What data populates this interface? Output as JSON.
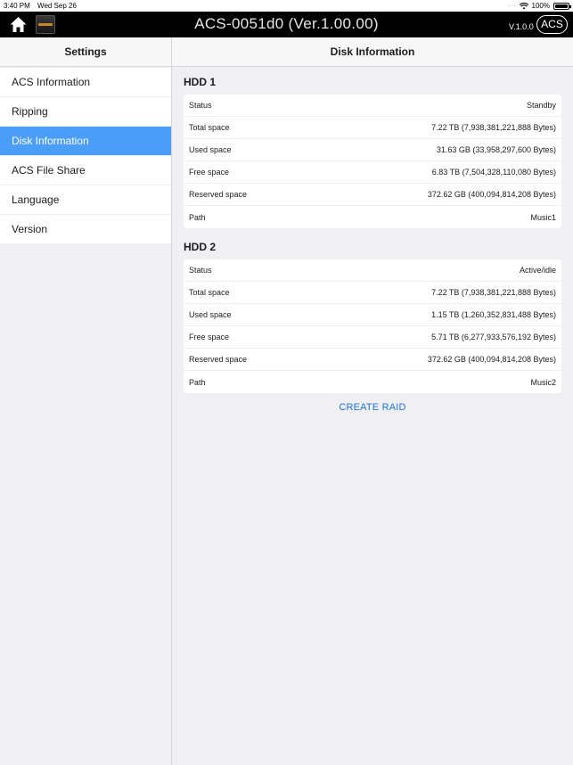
{
  "status_bar": {
    "time": "3:40 PM",
    "date": "Wed Sep 26",
    "battery": "100%",
    "battery_level": 1.0
  },
  "app_header": {
    "title": "ACS-0051d0 (Ver.1.00.00)",
    "version": "V.1.0.0",
    "badge": "ACS"
  },
  "sidebar": {
    "title": "Settings",
    "items": [
      {
        "label": "ACS Information"
      },
      {
        "label": "Ripping"
      },
      {
        "label": "Disk Information"
      },
      {
        "label": "ACS File Share"
      },
      {
        "label": "Language"
      },
      {
        "label": "Version"
      }
    ],
    "active_index": 2
  },
  "main": {
    "title": "Disk Information",
    "disks": [
      {
        "name": "HDD 1",
        "rows": [
          {
            "label": "Status",
            "value": "Standby"
          },
          {
            "label": "Total space",
            "value": "7.22 TB (7,938,381,221,888 Bytes)"
          },
          {
            "label": "Used space",
            "value": "31.63 GB (33,958,297,600 Bytes)"
          },
          {
            "label": "Free space",
            "value": "6.83 TB (7,504,328,110,080 Bytes)"
          },
          {
            "label": "Reserved space",
            "value": "372.62 GB (400,094,814,208 Bytes)"
          },
          {
            "label": "Path",
            "value": "Music1"
          }
        ]
      },
      {
        "name": "HDD 2",
        "rows": [
          {
            "label": "Status",
            "value": "Active/idle"
          },
          {
            "label": "Total space",
            "value": "7.22 TB (7,938,381,221,888 Bytes)"
          },
          {
            "label": "Used space",
            "value": "1.15 TB (1,260,352,831,488 Bytes)"
          },
          {
            "label": "Free space",
            "value": "5.71 TB (6,277,933,576,192 Bytes)"
          },
          {
            "label": "Reserved space",
            "value": "372.62 GB (400,094,814,208 Bytes)"
          },
          {
            "label": "Path",
            "value": "Music2"
          }
        ]
      }
    ],
    "create_raid_label": "CREATE RAID"
  },
  "colors": {
    "accent": "#4a9df8",
    "link": "#1a73d9",
    "header_bg": "#000000"
  }
}
